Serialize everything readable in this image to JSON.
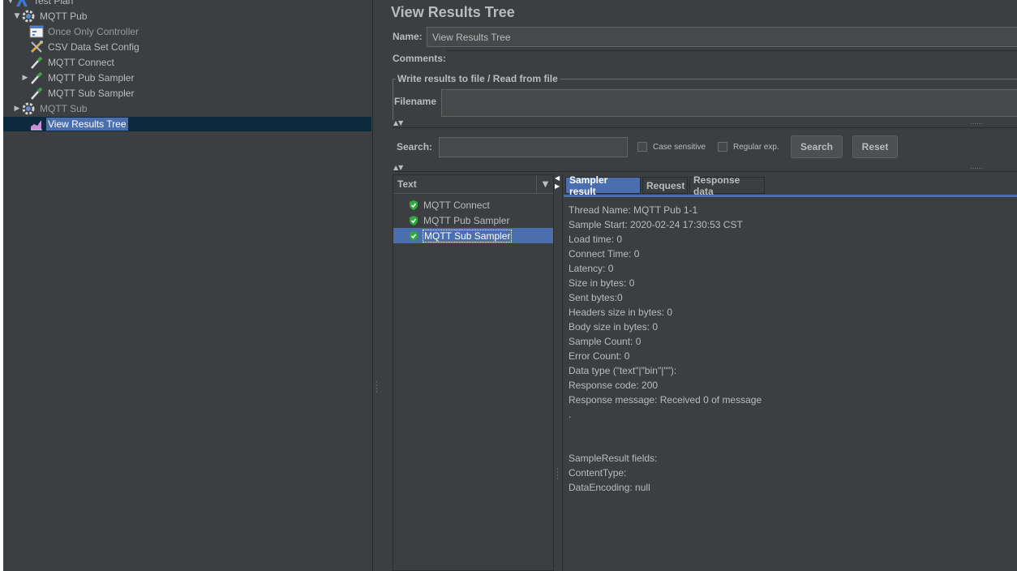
{
  "tree": {
    "items": [
      {
        "label": "Test Plan"
      },
      {
        "label": "MQTT Pub"
      },
      {
        "label": "Once Only Controller"
      },
      {
        "label": "CSV Data Set Config"
      },
      {
        "label": "MQTT Connect"
      },
      {
        "label": "MQTT Pub Sampler"
      },
      {
        "label": "MQTT Sub Sampler"
      },
      {
        "label": "MQTT Sub"
      },
      {
        "label": "View Results Tree"
      }
    ]
  },
  "panel": {
    "title": "View Results Tree",
    "name_label": "Name:",
    "name_value": "View Results Tree",
    "comments_label": "Comments:",
    "write_results_legend": "Write results to file / Read from file",
    "filename_label": "Filename"
  },
  "search": {
    "label": "Search:",
    "case_sensitive": "Case sensitive",
    "regular_exp": "Regular exp.",
    "search_button": "Search",
    "reset_button": "Reset"
  },
  "results": {
    "renderer": "Text",
    "items": [
      "MQTT Connect",
      "MQTT Pub Sampler",
      "MQTT Sub Sampler"
    ],
    "selected_index": 2
  },
  "tabs": [
    "Sampler result",
    "Request",
    "Response data"
  ],
  "sampler_result": {
    "lines": [
      "Thread Name: MQTT Pub 1-1",
      "Sample Start: 2020-02-24 17:30:53 CST",
      "Load time: 0",
      "Connect Time: 0",
      "Latency: 0",
      "Size in bytes: 0",
      "Sent bytes:0",
      "Headers size in bytes: 0",
      "Body size in bytes: 0",
      "Sample Count: 0",
      "Error Count: 0",
      "Data type (\"text\"|\"bin\"|\"\"):",
      "Response code: 200",
      "Response message: Received 0 of message",
      ".",
      "",
      "",
      "SampleResult fields:",
      "ContentType:",
      "DataEncoding: null"
    ]
  },
  "colors": {
    "background": "#3c3f41",
    "selection": "#4b6eaf",
    "tree_selection": "#0d293e",
    "success_icon": "#2eaa3f"
  }
}
